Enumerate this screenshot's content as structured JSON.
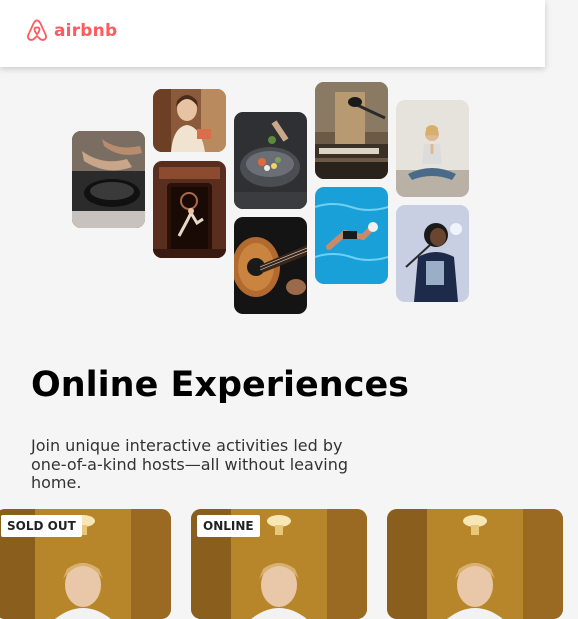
{
  "brand": {
    "name": "airbnb",
    "color": "#FF5A5F",
    "icon": "airbnb-logo-icon"
  },
  "hero": {
    "title": "Online Experiences",
    "subtitle": "Join unique interactive activities led by one-of-a-kind hosts—all without leaving home."
  },
  "photo_grid": [
    {
      "name": "cooking-photo"
    },
    {
      "name": "host-portrait-photo"
    },
    {
      "name": "dancer-doorway-photo"
    },
    {
      "name": "food-bowl-photo"
    },
    {
      "name": "guitar-photo"
    },
    {
      "name": "microphone-studio-photo"
    },
    {
      "name": "swimmer-photo"
    },
    {
      "name": "yoga-photo"
    },
    {
      "name": "singer-photo"
    }
  ],
  "cards": [
    {
      "badge": "SOLD OUT"
    },
    {
      "badge": "ONLINE"
    },
    {
      "badge": ""
    }
  ]
}
